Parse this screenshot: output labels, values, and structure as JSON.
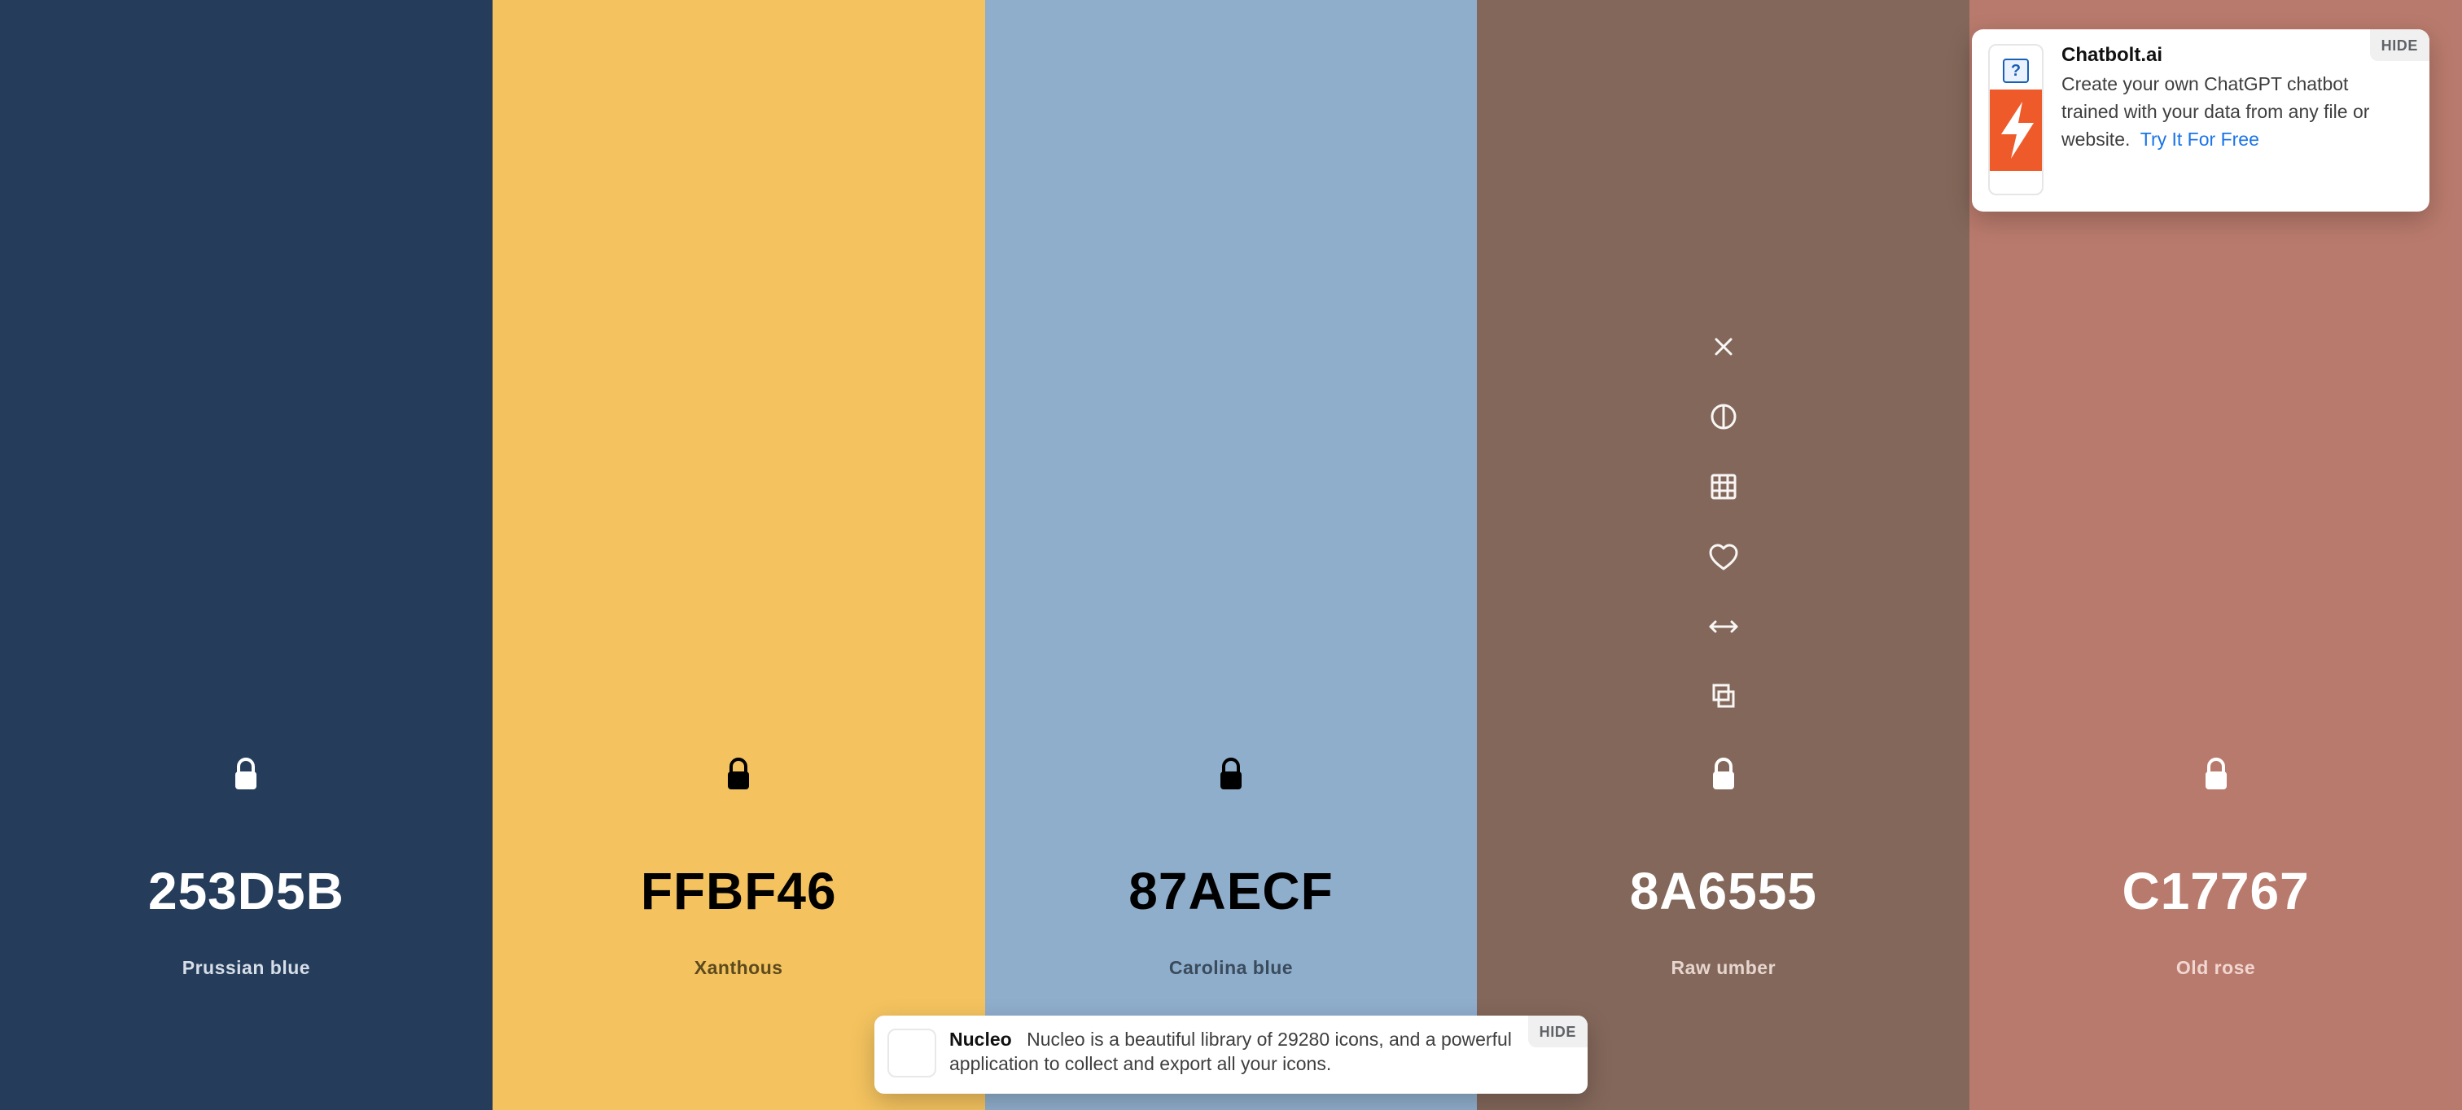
{
  "palette": {
    "colors": [
      {
        "hex": "253D5B",
        "name": "Prussian blue",
        "bg": "#253D5B",
        "hex_text_color": "#FFFFFF",
        "name_text_color": "#D7DEE8",
        "lock_color": "#FFFFFF",
        "lock_style": "unlocked"
      },
      {
        "hex": "FFBF46",
        "name": "Xanthous",
        "bg": "#F4C35F",
        "hex_text_color": "#000000",
        "name_text_color": "#5C4A1D",
        "lock_color": "#000000",
        "lock_style": "locked"
      },
      {
        "hex": "87AECF",
        "name": "Carolina blue",
        "bg": "#8FAECC",
        "hex_text_color": "#000000",
        "name_text_color": "#3A4B5C",
        "lock_color": "#000000",
        "lock_style": "locked"
      },
      {
        "hex": "8A6555",
        "name": "Raw umber",
        "bg": "#83675A",
        "hex_text_color": "#FFFFFF",
        "name_text_color": "#E7D6CF",
        "lock_color": "#FFFFFF",
        "lock_style": "unlocked"
      },
      {
        "hex": "C17767",
        "name": "Old rose",
        "bg": "#B87A6C",
        "hex_text_color": "#FFFFFF",
        "name_text_color": "#F1D7D1",
        "lock_color": "#FFFFFF",
        "lock_style": "unlocked"
      }
    ],
    "tools_column_index": 3,
    "tools": [
      {
        "icon": "close-icon"
      },
      {
        "icon": "contrast-icon"
      },
      {
        "icon": "grid-icon"
      },
      {
        "icon": "heart-icon"
      },
      {
        "icon": "resize-horizontal-icon"
      },
      {
        "icon": "copy-icon"
      }
    ]
  },
  "ads": {
    "chatbolt": {
      "hide_label": "HIDE",
      "title": "Chatbolt.ai",
      "body": "Create your own ChatGPT chatbot trained with your data from any file or website.",
      "cta": "Try It For Free"
    },
    "nucleo": {
      "hide_label": "HIDE",
      "title": "Nucleo",
      "body": "Nucleo is a beautiful library of 29280 icons, and a powerful application to collect and export all your icons."
    }
  }
}
